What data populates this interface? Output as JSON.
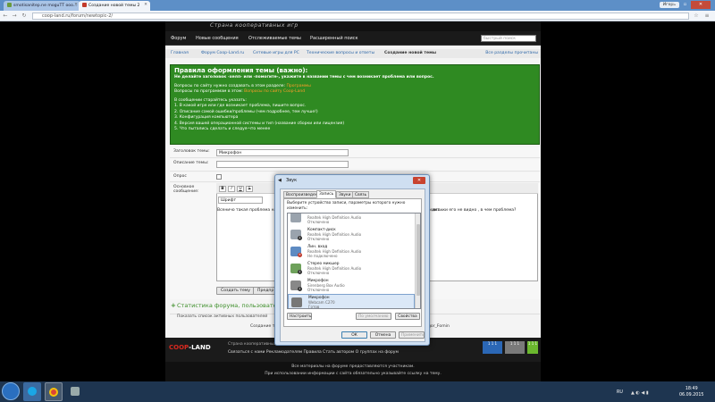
{
  "browser": {
    "tabs": [
      {
        "label": "smotisanitep.ne moguTT ooo..."
      },
      {
        "label": "Создание новой темы 2"
      }
    ],
    "user_label": "Игорь",
    "address": "coop-land.ru/forum/newtopic-2/"
  },
  "site": {
    "tagline": "Страна кооперативных игр",
    "nav": [
      "Форум",
      "Новые сообщения",
      "Отслеживаемые темы",
      "Расширенный поиск"
    ],
    "search_placeholder": "быстрый поиск",
    "breadcrumbs": [
      "Главная",
      "Форум Coop-Land.ru",
      "Сетевые игры для PC",
      "Технические вопросы и ответы",
      "Создание новой темы"
    ],
    "breadcrumb_right": "Все разделы прочитаны"
  },
  "rules": {
    "title": "Правила оформления темы (важно):",
    "warning": "Не делайте заголовок -хелп- или -помогите-, укажите в названии темы с чем возникает проблема или вопрос.",
    "q_site": "Вопросы по сайту нужно создавать в этом разделе:",
    "q_site_link": "Программы",
    "q_prog": "Вопросы по программам в этом:",
    "q_prog_link": "Вопросы по сайту Coop-Land",
    "must": "В сообщении старайтесь указать:",
    "items": [
      "1. В какой игре или где возникает проблема, пишите вопрос.",
      "2. Описание самой ошибки/проблемы (чем подробнее, тем лучше!)",
      "3. Конфигурация компьютера",
      "4. Версия вашей операционной системы и тип (название сборки или лицензия)",
      "5. Что пытались сделать и следуя-что менее"
    ]
  },
  "form": {
    "title_label": "Заголовок темы:",
    "title_value": "Микрофон",
    "desc_label": "Описание темы:",
    "poll_label": "Опрос",
    "msg_label": "Основное сообщение:",
    "toolbar": [
      "B",
      "I",
      "U",
      "S"
    ],
    "font": "Шрифт",
    "message_text": "Всеничо такая проблема на компе и на ноутбуке иконка микрофона появлялась, но при звуке не видит...",
    "message_right": "иконки его не видно , в чем проблема?",
    "submit": "Создать тему",
    "preview": "Предпр"
  },
  "stats": {
    "title": "Статистика форума, пользователей он",
    "show_list": "Показать список активных пользователей",
    "bottom_center": "Создание тем",
    "bottom_right": "Сейчас на сайте: Igor_Fomin"
  },
  "footer": {
    "logo_a": "COOP",
    "logo_b": "-LAND",
    "desc": "Страна кооперативных игр ...",
    "links": "Связаться с нами   Рекламодателям   Правила   Стать автором   О группах на форум",
    "counters": [
      "1 1 1",
      "1 1 1",
      "1 1 1"
    ]
  },
  "copyright": {
    "line1": "Все материалы на форуме предоставляются участникам.",
    "line2": "При использовании информации с сайта обязательно указывайте ссылку на тему."
  },
  "dialog": {
    "title": "Звук",
    "tabs": [
      "Воспроизведение",
      "Запись",
      "Звуки",
      "Связь"
    ],
    "instruction": "Выберите устройство записи, параметры которого нужно изменить:",
    "devices": [
      {
        "name": "",
        "driver": "Realtek High Definition Audio",
        "status": "Отключено"
      },
      {
        "name": "Компакт-диск",
        "driver": "Realtek High Definition Audio",
        "status": "Отключено"
      },
      {
        "name": "Лин. вход",
        "driver": "Realtek High Definition Audio",
        "status": "Не подключено"
      },
      {
        "name": "Стерео микшер",
        "driver": "Realtek High Definition Audio",
        "status": "Отключено"
      },
      {
        "name": "Микрофон",
        "driver": "Sirenberg Box Audio",
        "status": "Отключено"
      },
      {
        "name": "Микрофон",
        "driver": "Webcam C270",
        "status": "Готов"
      }
    ],
    "configure": "Настроить",
    "default": "По умолчанию",
    "properties": "Свойства",
    "ok": "ОК",
    "cancel": "Отмена",
    "apply": "Применить"
  },
  "taskbar": {
    "lang": "RU",
    "time": "18:49",
    "date": "06.09.2015"
  }
}
